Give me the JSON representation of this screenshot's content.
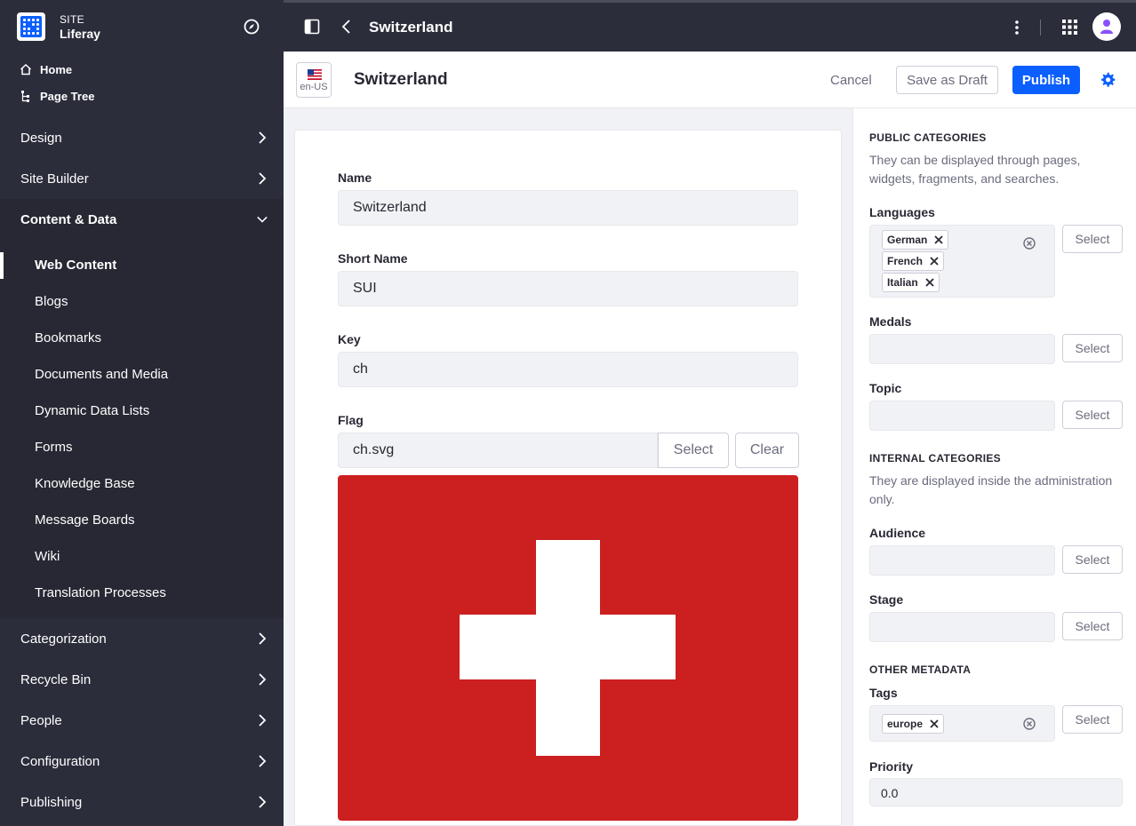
{
  "sidebar": {
    "site_label": "SITE",
    "site_name": "Liferay",
    "home": "Home",
    "page_tree": "Page Tree",
    "sections": {
      "design": "Design",
      "site_builder": "Site Builder",
      "content_data": "Content & Data",
      "categorization": "Categorization",
      "recycle_bin": "Recycle Bin",
      "people": "People",
      "configuration": "Configuration",
      "publishing": "Publishing"
    },
    "content_items": [
      "Web Content",
      "Blogs",
      "Bookmarks",
      "Documents and Media",
      "Dynamic Data Lists",
      "Forms",
      "Knowledge Base",
      "Message Boards",
      "Wiki",
      "Translation Processes"
    ]
  },
  "topbar": {
    "title": "Switzerland"
  },
  "header": {
    "locale": "en-US",
    "title": "Switzerland",
    "cancel": "Cancel",
    "save_draft": "Save as Draft",
    "publish": "Publish"
  },
  "form": {
    "name_label": "Name",
    "name_value": "Switzerland",
    "short_name_label": "Short Name",
    "short_name_value": "SUI",
    "key_label": "Key",
    "key_value": "ch",
    "flag_label": "Flag",
    "flag_value": "ch.svg",
    "select": "Select",
    "clear": "Clear"
  },
  "right_panel": {
    "public_categories": "PUBLIC CATEGORIES",
    "public_desc": "They can be displayed through pages, widgets, fragments, and searches.",
    "languages_label": "Languages",
    "languages": [
      "German",
      "French",
      "Italian"
    ],
    "medals_label": "Medals",
    "topic_label": "Topic",
    "internal_categories": "INTERNAL CATEGORIES",
    "internal_desc": "They are displayed inside the administration only.",
    "audience_label": "Audience",
    "stage_label": "Stage",
    "other_metadata": "OTHER METADATA",
    "tags_label": "Tags",
    "tags": [
      "europe"
    ],
    "priority_label": "Priority",
    "priority_value": "0.0",
    "select": "Select"
  },
  "colors": {
    "sidebar_bg": "#2b2d3b",
    "primary": "#0b5fff",
    "flag_red": "#cc1f20"
  }
}
